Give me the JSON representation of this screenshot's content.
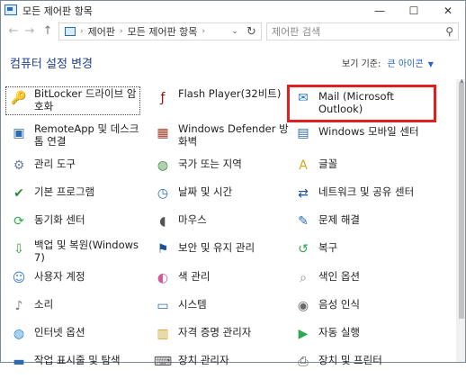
{
  "window": {
    "title": "모든 제어판 항목",
    "minimize": "—",
    "maximize": "☐",
    "close": "✕"
  },
  "nav": {
    "back": "←",
    "forward": "→",
    "up": "↑",
    "breadcrumb": [
      "제어판",
      "모든 제어판 항목"
    ],
    "refresh": "↻",
    "search_placeholder": "제어판 검색"
  },
  "header": {
    "title": "컴퓨터 설정 변경",
    "view_by_label": "보기 기준:",
    "view_by_value": "큰 아이콘"
  },
  "items": [
    {
      "label": "BitLocker 드라이브 암호화",
      "icon": "bitlocker-icon",
      "color": "#c9a227"
    },
    {
      "label": "Flash Player(32비트)",
      "icon": "flash-icon",
      "color": "#8b1010"
    },
    {
      "label": "Mail (Microsoft Outlook)",
      "icon": "mail-icon",
      "color": "#2b7bc8"
    },
    {
      "label": "RemoteApp 및 데스크톱 연결",
      "icon": "remoteapp-icon",
      "color": "#2b6cb0"
    },
    {
      "label": "Windows Defender 방화벽",
      "icon": "firewall-icon",
      "color": "#a23b2a"
    },
    {
      "label": "Windows 모바일 센터",
      "icon": "mobility-center-icon",
      "color": "#2b6cb0"
    },
    {
      "label": "관리 도구",
      "icon": "admin-tools-icon",
      "color": "#6a7f99"
    },
    {
      "label": "국가 또는 지역",
      "icon": "region-icon",
      "color": "#3c8c3c"
    },
    {
      "label": "글꼴",
      "icon": "fonts-icon",
      "color": "#d9a520"
    },
    {
      "label": "기본 프로그램",
      "icon": "default-programs-icon",
      "color": "#2b8a3e"
    },
    {
      "label": "날짜 및 시간",
      "icon": "datetime-icon",
      "color": "#2b6cb0"
    },
    {
      "label": "네트워크 및 공유 센터",
      "icon": "network-icon",
      "color": "#1f4f99"
    },
    {
      "label": "동기화 센터",
      "icon": "sync-center-icon",
      "color": "#2fa84f"
    },
    {
      "label": "마우스",
      "icon": "mouse-icon",
      "color": "#555555"
    },
    {
      "label": "문제 해결",
      "icon": "troubleshooting-icon",
      "color": "#2b6cb0"
    },
    {
      "label": "백업 및 복원(Windows 7)",
      "icon": "backup-icon",
      "color": "#3a9a3a"
    },
    {
      "label": "보안 및 유지 관리",
      "icon": "security-flag-icon",
      "color": "#1f4f99"
    },
    {
      "label": "복구",
      "icon": "recovery-icon",
      "color": "#2fa84f"
    },
    {
      "label": "사용자 계정",
      "icon": "user-accounts-icon",
      "color": "#3a7fc8"
    },
    {
      "label": "색 관리",
      "icon": "color-management-icon",
      "color": "#d05a9a"
    },
    {
      "label": "색인 옵션",
      "icon": "indexing-icon",
      "color": "#8a8a8a"
    },
    {
      "label": "소리",
      "icon": "sound-icon",
      "color": "#7a7a7a"
    },
    {
      "label": "시스템",
      "icon": "system-icon",
      "color": "#2b6cb0"
    },
    {
      "label": "음성 인식",
      "icon": "speech-icon",
      "color": "#6a6a6a"
    },
    {
      "label": "인터넷 옵션",
      "icon": "internet-options-icon",
      "color": "#2b8ad6"
    },
    {
      "label": "자격 증명 관리자",
      "icon": "credential-manager-icon",
      "color": "#c9a227"
    },
    {
      "label": "자동 실행",
      "icon": "autoplay-icon",
      "color": "#2fa84f"
    },
    {
      "label": "작업 표시줄 및 탐색",
      "icon": "taskbar-icon",
      "color": "#2b6cb0"
    },
    {
      "label": "장치 관리자",
      "icon": "device-manager-icon",
      "color": "#555555"
    },
    {
      "label": "장치 및 프린터",
      "icon": "devices-printers-icon",
      "color": "#555555"
    }
  ]
}
